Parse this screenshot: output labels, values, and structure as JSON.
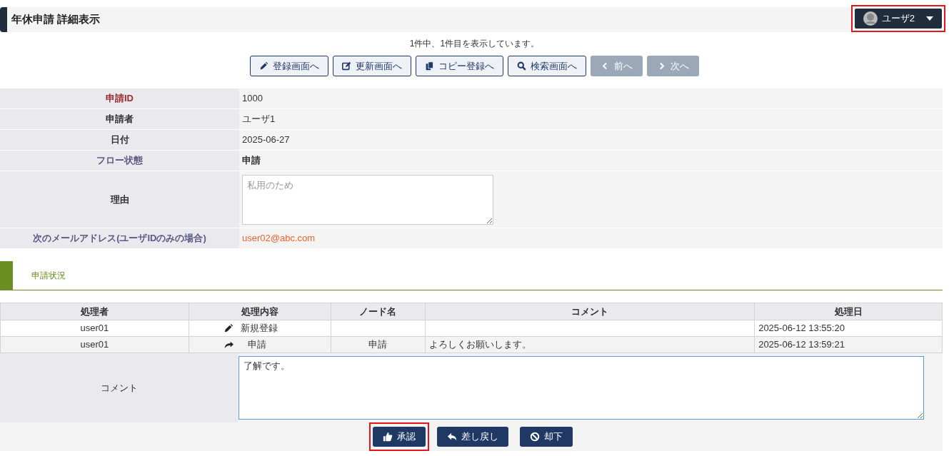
{
  "header": {
    "title": "年休申請 詳細表示",
    "user_menu": {
      "label": "ユーザ2",
      "highlighted": true
    }
  },
  "record_info": "1件中、1件目を表示しています。",
  "nav_buttons": [
    {
      "label": "登録画面へ",
      "disabled": false
    },
    {
      "label": "更新画面へ",
      "disabled": false
    },
    {
      "label": "コピー登録へ",
      "disabled": false
    },
    {
      "label": "検索画面へ",
      "disabled": false
    },
    {
      "label": "前へ",
      "disabled": true
    },
    {
      "label": "次へ",
      "disabled": true
    }
  ],
  "details": [
    {
      "label": "申請ID",
      "color": "#9b2c2c",
      "kind": "text",
      "value": "1000"
    },
    {
      "label": "申請者",
      "color": "#333333",
      "kind": "text",
      "value": "ユーザ1"
    },
    {
      "label": "日付",
      "color": "#333333",
      "kind": "text",
      "value": "2025-06-27"
    },
    {
      "label": "フロー状態",
      "color": "#5b5b86",
      "kind": "strong",
      "value": "申請"
    },
    {
      "label": "理由",
      "color": "#333333",
      "kind": "textarea",
      "placeholder": "私用のため"
    },
    {
      "label": "次のメールアドレス(ユーザIDのみの場合)",
      "color": "#5b5b86",
      "kind": "link",
      "value": "user02@abc.com"
    }
  ],
  "status_section": {
    "title": "申請状況",
    "columns": [
      "処理者",
      "処理内容",
      "ノード名",
      "コメント",
      "処理日"
    ],
    "rows": [
      {
        "user": "user01",
        "action": "新規登録",
        "node": "",
        "comment": "",
        "date": "2025-06-12 13:55:20"
      },
      {
        "user": "user01",
        "action": "申請",
        "node": "申請",
        "comment": "よろしくお願いします。",
        "date": "2025-06-12 13:59:21"
      }
    ],
    "comment_label": "コメント",
    "comment_value": "了解です。"
  },
  "action_buttons": [
    {
      "label": "承認",
      "highlighted": true
    },
    {
      "label": "差し戻し",
      "highlighted": false
    },
    {
      "label": "却下",
      "highlighted": false
    }
  ]
}
